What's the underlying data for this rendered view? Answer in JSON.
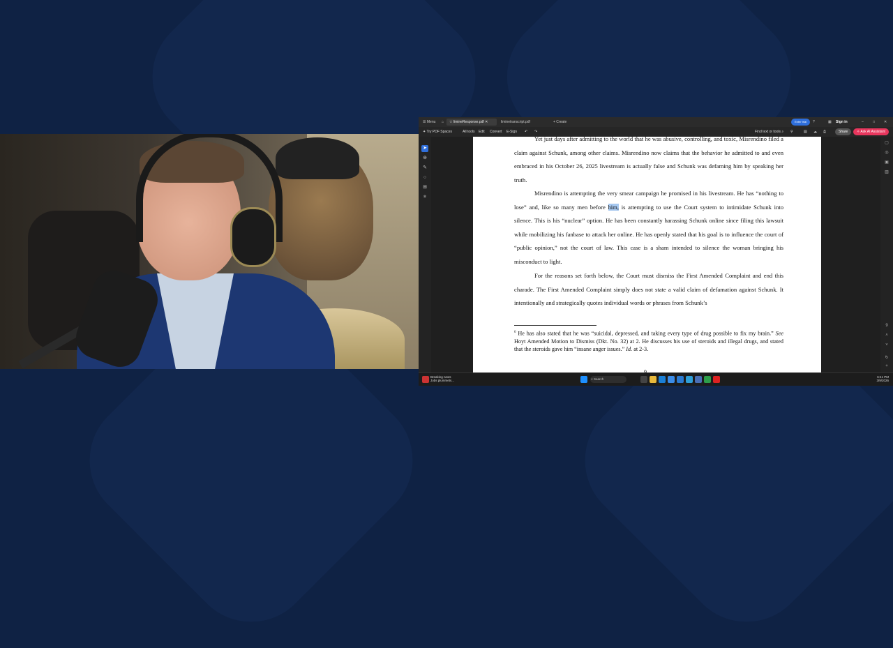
{
  "background": {
    "color": "#0f2244"
  },
  "webcam": {
    "description_icon": "person-with-headphones"
  },
  "window": {
    "menu_label": "Menu",
    "tabs": [
      {
        "label": "limineResponse.pdf",
        "active": true
      },
      {
        "label": "liminetranscript.pdf",
        "active": false
      }
    ],
    "create_label": "+ Create",
    "upgrade_label": "Enter trial",
    "signin_label": "Sign in"
  },
  "toolbar": {
    "spaces_label": "Try PDF Spaces",
    "items": [
      "All tools",
      "Edit",
      "Convert",
      "E-Sign"
    ],
    "find_label": "Find text or tools",
    "share_label": "Share",
    "assistant_label": "Ask AI Assistant",
    "accent": "#e8365d"
  },
  "document": {
    "paragraph1": "Yet just days after admitting to the world that he was abusive, controlling, and toxic, Misrendino filed a claim against Schunk, among other claims.  Misrendino now claims that the behavior he admitted to and even embraced in his October 26, 2025 livestream is actually false and Schunk was defaming him by speaking her truth.",
    "paragraph2_before": "Misrendino is attempting the very smear campaign he promised in his livestream.  He has “nothing to lose” and, like so many men before ",
    "paragraph2_highlight": "him,",
    "paragraph2_after": " is attempting to use the Court system to intimidate Schunk into silence.  This is his “nuclear” option.   He has been constantly harassing Schunk online since filing this lawsuit while mobilizing his fanbase to attack her online.  He has openly stated that his goal is to influence the court of “public opinion,” not the court of law.  This case is a sham intended to silence the woman bringing his misconduct to light.",
    "paragraph3": "For the reasons set forth below, the Court must dismiss the First Amended Complaint and end this charade.  The First Amended Complaint simply does not state a valid claim of defamation against Schunk.  It intentionally and strategically quotes individual words or phrases from Schunk’s",
    "footnote_number": "6",
    "footnote_text_1": " He has also stated that he was “suicidal, depressed, and taking every type of drug possible to fix my brain.”  ",
    "footnote_see": "See",
    "footnote_text_2": " Hoyt Amended Motion to Dismiss (Dkt. No. 32) at 2.  He discusses his use of steroids and illegal drugs, and stated that the steroids gave him “insane anger issues.”  ",
    "footnote_id": "Id.",
    "footnote_text_3": " at 2-3.",
    "page_number": "9"
  },
  "taskbar": {
    "news_title": "Breaking news",
    "news_sub": "Jobs plummets...",
    "search_label": "Search",
    "time": "6:41 PM",
    "date": "3/9/2026"
  }
}
